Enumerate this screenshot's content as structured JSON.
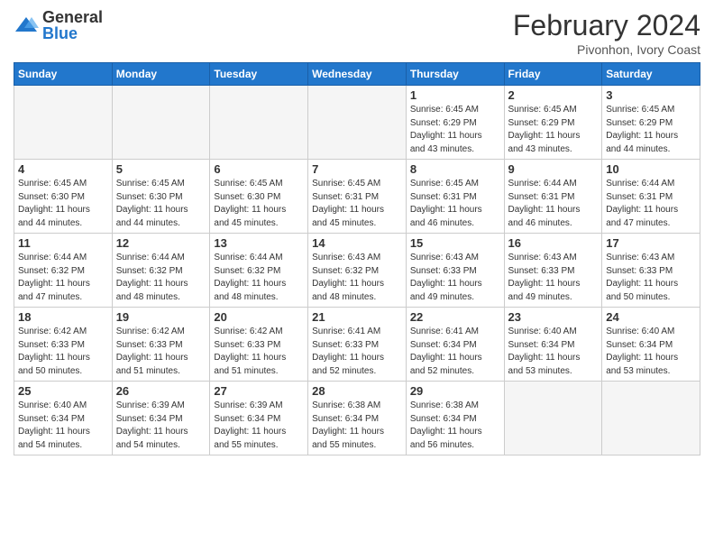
{
  "logo": {
    "general": "General",
    "blue": "Blue"
  },
  "header": {
    "month": "February 2024",
    "location": "Pivonhon, Ivory Coast"
  },
  "days_of_week": [
    "Sunday",
    "Monday",
    "Tuesday",
    "Wednesday",
    "Thursday",
    "Friday",
    "Saturday"
  ],
  "weeks": [
    [
      {
        "day": "",
        "info": "",
        "empty": true
      },
      {
        "day": "",
        "info": "",
        "empty": true
      },
      {
        "day": "",
        "info": "",
        "empty": true
      },
      {
        "day": "",
        "info": "",
        "empty": true
      },
      {
        "day": "1",
        "info": "Sunrise: 6:45 AM\nSunset: 6:29 PM\nDaylight: 11 hours\nand 43 minutes."
      },
      {
        "day": "2",
        "info": "Sunrise: 6:45 AM\nSunset: 6:29 PM\nDaylight: 11 hours\nand 43 minutes."
      },
      {
        "day": "3",
        "info": "Sunrise: 6:45 AM\nSunset: 6:29 PM\nDaylight: 11 hours\nand 44 minutes."
      }
    ],
    [
      {
        "day": "4",
        "info": "Sunrise: 6:45 AM\nSunset: 6:30 PM\nDaylight: 11 hours\nand 44 minutes."
      },
      {
        "day": "5",
        "info": "Sunrise: 6:45 AM\nSunset: 6:30 PM\nDaylight: 11 hours\nand 44 minutes."
      },
      {
        "day": "6",
        "info": "Sunrise: 6:45 AM\nSunset: 6:30 PM\nDaylight: 11 hours\nand 45 minutes."
      },
      {
        "day": "7",
        "info": "Sunrise: 6:45 AM\nSunset: 6:31 PM\nDaylight: 11 hours\nand 45 minutes."
      },
      {
        "day": "8",
        "info": "Sunrise: 6:45 AM\nSunset: 6:31 PM\nDaylight: 11 hours\nand 46 minutes."
      },
      {
        "day": "9",
        "info": "Sunrise: 6:44 AM\nSunset: 6:31 PM\nDaylight: 11 hours\nand 46 minutes."
      },
      {
        "day": "10",
        "info": "Sunrise: 6:44 AM\nSunset: 6:31 PM\nDaylight: 11 hours\nand 47 minutes."
      }
    ],
    [
      {
        "day": "11",
        "info": "Sunrise: 6:44 AM\nSunset: 6:32 PM\nDaylight: 11 hours\nand 47 minutes."
      },
      {
        "day": "12",
        "info": "Sunrise: 6:44 AM\nSunset: 6:32 PM\nDaylight: 11 hours\nand 48 minutes."
      },
      {
        "day": "13",
        "info": "Sunrise: 6:44 AM\nSunset: 6:32 PM\nDaylight: 11 hours\nand 48 minutes."
      },
      {
        "day": "14",
        "info": "Sunrise: 6:43 AM\nSunset: 6:32 PM\nDaylight: 11 hours\nand 48 minutes."
      },
      {
        "day": "15",
        "info": "Sunrise: 6:43 AM\nSunset: 6:33 PM\nDaylight: 11 hours\nand 49 minutes."
      },
      {
        "day": "16",
        "info": "Sunrise: 6:43 AM\nSunset: 6:33 PM\nDaylight: 11 hours\nand 49 minutes."
      },
      {
        "day": "17",
        "info": "Sunrise: 6:43 AM\nSunset: 6:33 PM\nDaylight: 11 hours\nand 50 minutes."
      }
    ],
    [
      {
        "day": "18",
        "info": "Sunrise: 6:42 AM\nSunset: 6:33 PM\nDaylight: 11 hours\nand 50 minutes."
      },
      {
        "day": "19",
        "info": "Sunrise: 6:42 AM\nSunset: 6:33 PM\nDaylight: 11 hours\nand 51 minutes."
      },
      {
        "day": "20",
        "info": "Sunrise: 6:42 AM\nSunset: 6:33 PM\nDaylight: 11 hours\nand 51 minutes."
      },
      {
        "day": "21",
        "info": "Sunrise: 6:41 AM\nSunset: 6:33 PM\nDaylight: 11 hours\nand 52 minutes."
      },
      {
        "day": "22",
        "info": "Sunrise: 6:41 AM\nSunset: 6:34 PM\nDaylight: 11 hours\nand 52 minutes."
      },
      {
        "day": "23",
        "info": "Sunrise: 6:40 AM\nSunset: 6:34 PM\nDaylight: 11 hours\nand 53 minutes."
      },
      {
        "day": "24",
        "info": "Sunrise: 6:40 AM\nSunset: 6:34 PM\nDaylight: 11 hours\nand 53 minutes."
      }
    ],
    [
      {
        "day": "25",
        "info": "Sunrise: 6:40 AM\nSunset: 6:34 PM\nDaylight: 11 hours\nand 54 minutes."
      },
      {
        "day": "26",
        "info": "Sunrise: 6:39 AM\nSunset: 6:34 PM\nDaylight: 11 hours\nand 54 minutes."
      },
      {
        "day": "27",
        "info": "Sunrise: 6:39 AM\nSunset: 6:34 PM\nDaylight: 11 hours\nand 55 minutes."
      },
      {
        "day": "28",
        "info": "Sunrise: 6:38 AM\nSunset: 6:34 PM\nDaylight: 11 hours\nand 55 minutes."
      },
      {
        "day": "29",
        "info": "Sunrise: 6:38 AM\nSunset: 6:34 PM\nDaylight: 11 hours\nand 56 minutes."
      },
      {
        "day": "",
        "info": "",
        "empty": true
      },
      {
        "day": "",
        "info": "",
        "empty": true
      }
    ]
  ]
}
